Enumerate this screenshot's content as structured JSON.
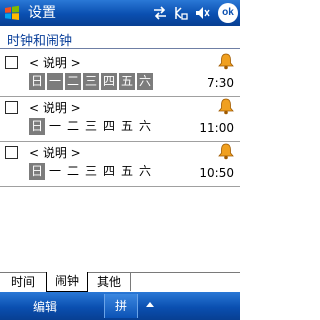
{
  "titlebar": {
    "app_title": "设置",
    "ok_label": "ok",
    "icons": [
      "start-icon",
      "connectivity-icon",
      "signal-icon",
      "volume-icon"
    ]
  },
  "section": {
    "title": "时钟和闹钟"
  },
  "alarms": [
    {
      "description": "< 说明 >",
      "time": "7:30",
      "checked": false,
      "days": [
        {
          "label": "日",
          "on": true
        },
        {
          "label": "一",
          "on": true
        },
        {
          "label": "二",
          "on": true
        },
        {
          "label": "三",
          "on": true
        },
        {
          "label": "四",
          "on": true
        },
        {
          "label": "五",
          "on": true
        },
        {
          "label": "六",
          "on": true
        }
      ]
    },
    {
      "description": "< 说明 >",
      "time": "11:00",
      "checked": false,
      "days": [
        {
          "label": "日",
          "on": true
        },
        {
          "label": "一",
          "on": false
        },
        {
          "label": "二",
          "on": false
        },
        {
          "label": "三",
          "on": false
        },
        {
          "label": "四",
          "on": false
        },
        {
          "label": "五",
          "on": false
        },
        {
          "label": "六",
          "on": false
        }
      ]
    },
    {
      "description": "< 说明 >",
      "time": "10:50",
      "checked": false,
      "days": [
        {
          "label": "日",
          "on": true
        },
        {
          "label": "一",
          "on": false
        },
        {
          "label": "二",
          "on": false
        },
        {
          "label": "三",
          "on": false
        },
        {
          "label": "四",
          "on": false
        },
        {
          "label": "五",
          "on": false
        },
        {
          "label": "六",
          "on": false
        }
      ]
    }
  ],
  "tabs": [
    {
      "label": "时间",
      "active": false
    },
    {
      "label": "闹钟",
      "active": true
    },
    {
      "label": "其他",
      "active": false
    }
  ],
  "menubar": {
    "left_label": "编辑",
    "sip_label": "拼"
  },
  "colors": {
    "titlebar": "#0a4fb0",
    "day_on": "#7c7c7c",
    "section_text": "#0a3f9a",
    "bell": "#f0a020"
  }
}
